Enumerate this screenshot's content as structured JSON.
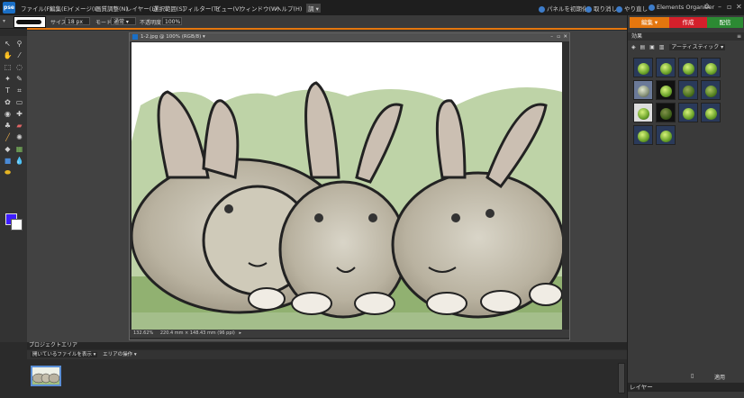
{
  "app": {
    "logo": "pse"
  },
  "menubar": {
    "items": [
      "ファイル(F)",
      "編集(E)",
      "イメージ(I)",
      "画質調整(N)",
      "レイヤー(L)",
      "選択範囲(S)",
      "フィルター(T)",
      "ビュー(V)",
      "ウィンドウ(W)",
      "ヘルプ(H)"
    ],
    "workspace_label": "調",
    "right": {
      "panel_reset": "パネルを初期化",
      "undo": "取り消し",
      "redo": "やり直し",
      "organizer": "Elements Organizer"
    }
  },
  "options": {
    "size_label": "サイズ：",
    "size_value": "18 px",
    "mode_label": "モード：",
    "mode_value": "通常",
    "opacity_label": "不透明度：",
    "opacity_value": "100%"
  },
  "document": {
    "title": "1-2.jpg @ 100% (RGB/8)",
    "status_zoom": "132.62%",
    "status_size": "220.4 mm × 148.43 mm (96 ppi)"
  },
  "right_panel": {
    "tabs": [
      "編集",
      "作成",
      "配信"
    ],
    "tab_colors": [
      "#e4760e",
      "#d4202b",
      "#2c8a33"
    ],
    "effects_title": "効果",
    "effects_category": "アーティスティック",
    "apply_label": "適用",
    "layers_label": "レイヤー"
  },
  "project_bin": {
    "title": "プロジェクトエリア",
    "show_open_files": "開いているファイルを表示",
    "area_actions": "エリアの操作"
  }
}
